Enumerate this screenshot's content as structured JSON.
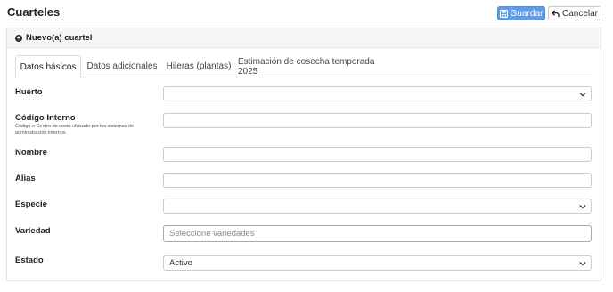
{
  "header": {
    "title": "Cuarteles"
  },
  "toolbar": {
    "save_label": "Guardar",
    "cancel_label": "Cancelar"
  },
  "panel": {
    "title": "Nuevo(a) cuartel"
  },
  "tabs": [
    {
      "label": "Datos básicos",
      "active": true
    },
    {
      "label": "Datos adicionales",
      "active": false
    },
    {
      "label": "Hileras (plantas)",
      "active": false
    },
    {
      "label": "Estimación de cosecha temporada 2025",
      "active": false
    }
  ],
  "form": {
    "huerto": {
      "label": "Huerto",
      "value": ""
    },
    "codigo": {
      "label": "Código Interno",
      "help": "Código o Centro de costo utilizado por los sistemas de administración internos.",
      "value": ""
    },
    "nombre": {
      "label": "Nombre",
      "value": ""
    },
    "alias": {
      "label": "Alias",
      "value": ""
    },
    "especie": {
      "label": "Especie",
      "value": ""
    },
    "variedad": {
      "label": "Variedad",
      "placeholder": "Seleccione variedades"
    },
    "estado": {
      "label": "Estado",
      "value": "Activo"
    }
  },
  "colors": {
    "primary": "#5f9be6",
    "border": "#cccccc"
  }
}
